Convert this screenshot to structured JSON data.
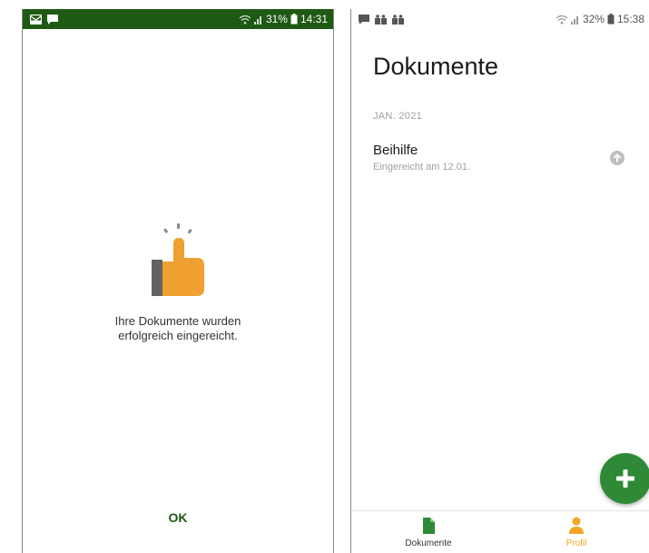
{
  "left_screen": {
    "status_bar": {
      "left_icons": [
        "mail-notification-icon",
        "chat-notification-icon"
      ],
      "battery_percent": "31%",
      "time": "14:31"
    },
    "illustration": {
      "icon": "thumbs-up-icon",
      "colors": {
        "thumb": "#f0a030",
        "cuff": "#5f6361",
        "sparks": "#8a8a8a"
      }
    },
    "message_line1": "Ihre Dokumente wurden",
    "message_line2": "erfolgreich eingereicht.",
    "ok_label": "OK"
  },
  "right_screen": {
    "status_bar": {
      "left_icons": [
        "chat-notification-icon",
        "teams-icon",
        "teams-icon"
      ],
      "battery_percent": "32%",
      "time": "15:38"
    },
    "title": "Dokumente",
    "section": "JAN. 2021",
    "documents": [
      {
        "title": "Beihilfe",
        "subtitle": "Eingereicht am 12.01.",
        "status_icon": "upload-icon"
      }
    ],
    "fab_icon": "plus-icon",
    "bottom_nav": [
      {
        "label": "Dokumente",
        "icon": "document-icon"
      },
      {
        "label": "Profil",
        "icon": "person-icon"
      }
    ]
  },
  "colors": {
    "brand_green": "#1f5a15",
    "fab_green": "#2e8a37",
    "accent_orange": "#f5a623"
  }
}
